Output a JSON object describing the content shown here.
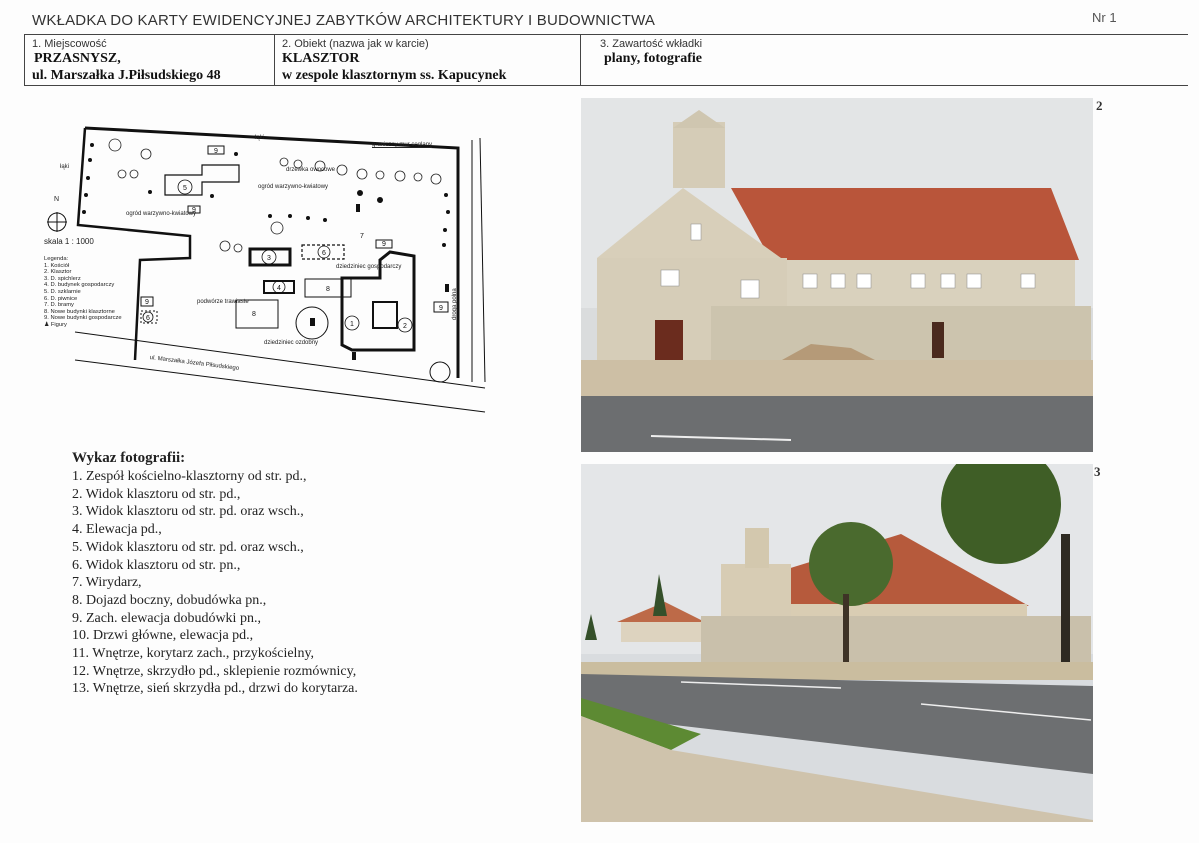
{
  "header": {
    "title": "WKŁADKA DO KARTY EWIDENCYJNEJ ZABYTKÓW ARCHITEKTURY I BUDOWNICTWA",
    "number": "Nr 1"
  },
  "fields": [
    {
      "label": "1. Miejscowość",
      "value_line1": "PRZASNYSZ,",
      "value_line2": "ul. Marszałka J.Piłsudskiego 48"
    },
    {
      "label": "2. Obiekt (nazwa jak w karcie)",
      "value_line1": "KLASZTOR",
      "value_line2": "w zespole klasztornym ss. Kapucynek"
    },
    {
      "label": "3. Zawartość wkładki",
      "value_line1": "plany, fotografie"
    }
  ],
  "plan": {
    "labels": {
      "laki_top": "łąki",
      "laki_left": "łąki",
      "wall": "graniczny mur ceglany",
      "orchard": "drzewka owocowe",
      "garden1": "ogród warzywno-kwiatowy",
      "garden2": "ogród warzywno-kwiatowy",
      "farmyard": "dziedziniec gospodarczy",
      "grass_yard": "podwórze trawiaste",
      "decor_yard": "dziedziniec ozdobny",
      "street": "ul. Marszałka Józefa Piłsudskiego",
      "field_road": "droga polna",
      "north": "N",
      "scale": "skala 1 : 1000"
    },
    "legend_title": "Legenda:",
    "legend": [
      "1. Kościół",
      "2. Klasztor",
      "3. D. spichlerz",
      "4. D. budynek gospodarczy",
      "5. D. szklarnie",
      "6. D. piwnice",
      "7. D. bramy",
      "8. Nowe budynki klasztorne",
      "9. Nowe budynki gospodarcze",
      "Figury"
    ],
    "markers": [
      "1",
      "2",
      "3",
      "4",
      "5",
      "6",
      "7",
      "8",
      "8",
      "9",
      "9",
      "9",
      "9",
      "9",
      "9"
    ]
  },
  "photos_list": {
    "title": "Wykaz fotografii:",
    "items": [
      "1. Zespół kościelno-klasztorny od str. pd.,",
      "2. Widok klasztoru od str. pd.,",
      "3. Widok klasztoru od str. pd. oraz wsch.,",
      "4. Elewacja pd.,",
      "5. Widok klasztoru od str. pd. oraz wsch.,",
      "6. Widok klasztoru od str. pn.,",
      "7. Wirydarz,",
      "8. Dojazd boczny, dobudówka pn.,",
      "9. Zach. elewacja dobudówki pn.,",
      "10. Drzwi główne, elewacja pd.,",
      "11. Wnętrze, korytarz zach., przykościelny,",
      "12. Wnętrze, skrzydło pd., sklepienie rozmównicy,",
      "13. Wnętrze,  sień skrzydła pd., drzwi do korytarza."
    ]
  },
  "photos": [
    {
      "number": "2"
    },
    {
      "number": "3"
    }
  ]
}
